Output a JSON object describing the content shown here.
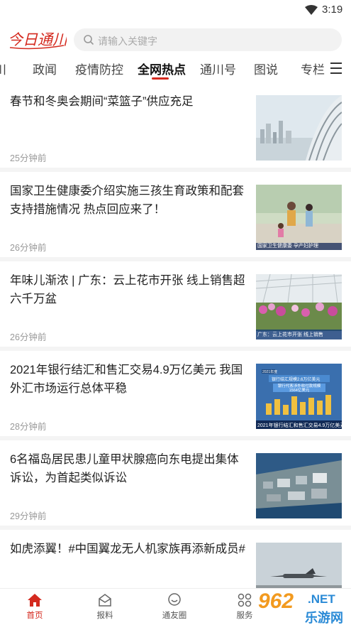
{
  "status_bar": {
    "time": "3:19"
  },
  "header": {
    "logo_text": "今日通川",
    "search_placeholder": "请输入关键字"
  },
  "tabs": [
    {
      "label": "川"
    },
    {
      "label": "政闻"
    },
    {
      "label": "疫情防控"
    },
    {
      "label": "全网热点",
      "active": true
    },
    {
      "label": "通川号"
    },
    {
      "label": "图说"
    },
    {
      "label": "专栏"
    }
  ],
  "news": [
    {
      "title": "春节和冬奥会期间“菜篮子”供应充足",
      "time": "25分钟前",
      "thumb": "city-bridge-image"
    },
    {
      "title": "国家卫生健康委介绍实施三孩生育政策和配套支持措施情况 热点回应来了！",
      "time": "26分钟前",
      "thumb": "family-park-image",
      "thumb_caption": "国家卫生健康委 孕产妇护理"
    },
    {
      "title": "年味儿渐浓 | 广东：云上花市开张 线上销售超六千万盆",
      "time": "26分钟前",
      "thumb": "flower-greenhouse-image",
      "thumb_caption": "广东：云上花市开张 线上销售"
    },
    {
      "title": "2021年银行结汇和售汇交易4.9万亿美元 我国外汇市场运行总体平稳",
      "time": "28分钟前",
      "thumb": "bar-chart-news-image",
      "thumb_caption": "2021年银行结汇和售汇交易4.9万亿美元",
      "thumb_tag": "2021年度",
      "thumb_box1": "银行结汇规模2.6万亿美元",
      "thumb_box2": "银行代客涉外收付款规模 1564亿美元"
    },
    {
      "title": "6名福岛居民患儿童甲状腺癌向东电提出集体诉讼，为首起类似诉讼",
      "time": "29分钟前",
      "thumb": "aerial-plant-image"
    },
    {
      "title": "如虎添翼！#中国翼龙无人机家族再添新成员#",
      "time": "",
      "thumb": "drone-image"
    }
  ],
  "bottom_nav": [
    {
      "label": "首页",
      "icon": "home-icon",
      "active": true
    },
    {
      "label": "报料",
      "icon": "mail-icon"
    },
    {
      "label": "通友圈",
      "icon": "chat-icon"
    },
    {
      "label": "服务",
      "icon": "grid-icon"
    }
  ],
  "watermark": {
    "brand": "962",
    "suffix": ".NET",
    "site": "乐游网"
  },
  "colors": {
    "accent": "#d42a1f",
    "text": "#222222",
    "muted": "#999999"
  }
}
